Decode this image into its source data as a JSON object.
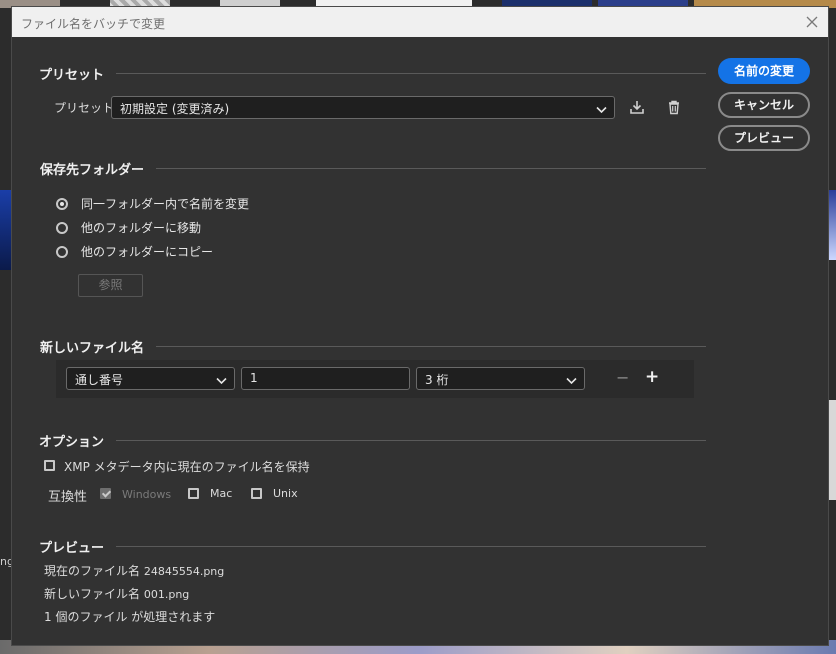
{
  "background": {
    "fragment_text": "ng"
  },
  "dialog": {
    "title": "ファイル名をバッチで変更",
    "close_icon": "close-icon"
  },
  "preset": {
    "heading": "プリセット",
    "label": "プリセット",
    "value": "初期設定 (変更済み)",
    "icons": [
      "save-icon",
      "trash-icon"
    ]
  },
  "buttons": {
    "rename": "名前の変更",
    "cancel": "キャンセル",
    "preview": "プレビュー"
  },
  "destination": {
    "heading": "保存先フォルダー",
    "options": [
      {
        "label": "同一フォルダー内で名前を変更",
        "selected": true
      },
      {
        "label": "他のフォルダーに移動",
        "selected": false
      },
      {
        "label": "他のフォルダーにコピー",
        "selected": false
      }
    ],
    "browse": "参照"
  },
  "new_name": {
    "heading": "新しいファイル名",
    "type": "通し番号",
    "start_value": "1",
    "digits": "3 桁",
    "minus": "−",
    "plus": "+"
  },
  "options": {
    "heading": "オプション",
    "keep_xmp": "XMP メタデータ内に現在のファイル名を保持",
    "compat_label": "互換性",
    "compat": [
      {
        "label": "Windows",
        "checked": true,
        "disabled": true
      },
      {
        "label": "Mac",
        "checked": false,
        "disabled": false
      },
      {
        "label": "Unix",
        "checked": false,
        "disabled": false
      }
    ]
  },
  "preview": {
    "heading": "プレビュー",
    "current_label": "現在のファイル名",
    "current_value": "24845554.png",
    "new_label": "新しいファイル名",
    "new_value": "001.png",
    "count_text": "1 個のファイル が処理されます"
  },
  "colors": {
    "accent": "#1473e6",
    "dialog_bg": "#323232",
    "field_bg": "#1f1f1f"
  }
}
